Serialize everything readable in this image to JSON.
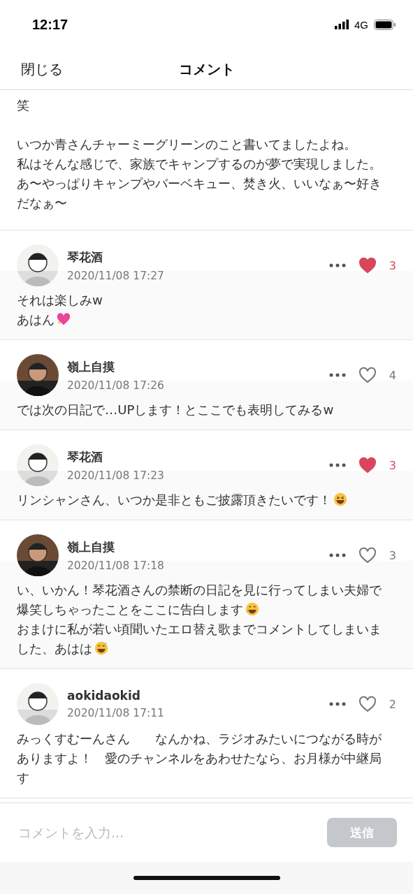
{
  "status_bar": {
    "time": "12:17",
    "network": "4G"
  },
  "header": {
    "close": "閉じる",
    "title": "コメント"
  },
  "partial_comment": {
    "blocks": [
      {
        "paragraphs": [
          {
            "text": "笑"
          }
        ]
      },
      {
        "paragraphs": [
          {
            "text": "いつか青さんチャーミーグリーンのこと書いてましたよね。"
          },
          {
            "text": "私はそんな感じで、家族でキャンプするのが夢で実現しました。"
          },
          {
            "text": "あ〜やっぱりキャンプやバーベキュー、焚き火、いいなぁ〜好きだなぁ〜"
          }
        ]
      }
    ]
  },
  "comments": [
    {
      "author": "琴花酒",
      "date": "2020/11/08 17:27",
      "liked": true,
      "likes": "3",
      "paragraphs": [
        {
          "text": "それは楽しみw"
        },
        {
          "text": "あはん",
          "kind": "heart"
        }
      ]
    },
    {
      "author": "嶺上自摸",
      "date": "2020/11/08 17:26",
      "liked": false,
      "likes": "4",
      "paragraphs": [
        {
          "text": "では次の日記で…UPします！とここでも表明してみるw"
        }
      ]
    },
    {
      "author": "琴花酒",
      "date": "2020/11/08 17:23",
      "liked": true,
      "likes": "3",
      "paragraphs": [
        {
          "text": "リンシャンさん、いつか是非ともご披露頂きたいです！",
          "kind": "laughing"
        }
      ]
    },
    {
      "author": "嶺上自摸",
      "date": "2020/11/08 17:18",
      "liked": false,
      "likes": "3",
      "paragraphs": [
        {
          "text": "い、いかん！琴花酒さんの禁断の日記を見に行ってしまい夫婦で爆笑しちゃったことをここに告白します",
          "kind": "rofl"
        },
        {
          "text": "おまけに私が若い頃聞いたエロ替え歌までコメントしてしまいました、あはは",
          "kind": "sweat"
        }
      ]
    },
    {
      "author": "aokidaokid",
      "date": "2020/11/08 17:11",
      "liked": false,
      "likes": "2",
      "paragraphs": [
        {
          "text": "みっくすむーんさん　　なんかね、ラジオみたいにつながる時がありますよ！　愛のチャンネルをあわせたなら、お月様が中継局す"
        }
      ]
    }
  ],
  "input": {
    "placeholder": "コメントを入力...",
    "send": "送信"
  }
}
